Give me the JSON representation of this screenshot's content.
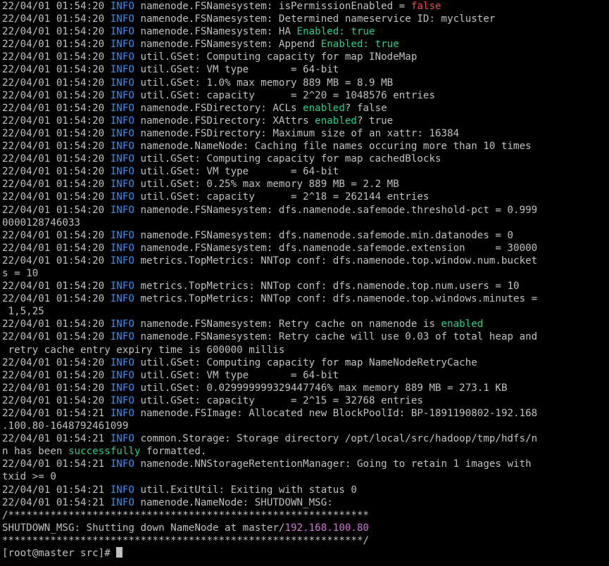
{
  "terminal": {
    "colors": {
      "background": "#000000",
      "foreground": "#c0c0c0",
      "info": "#3b8eea",
      "green": "#23d18b",
      "red": "#f14c4c",
      "magenta": "#d670d6"
    },
    "lines": [
      [
        [
          "22/04/01 01:54:20 ",
          "d"
        ],
        [
          "INFO",
          "i"
        ],
        [
          " namenode.FSNamesystem: isPermissionEnabled = ",
          "d"
        ],
        [
          "false",
          "r"
        ]
      ],
      [
        [
          "22/04/01 01:54:20 ",
          "d"
        ],
        [
          "INFO",
          "i"
        ],
        [
          " namenode.FSNamesystem: Determined nameservice ID: mycluster",
          "d"
        ]
      ],
      [
        [
          "22/04/01 01:54:20 ",
          "d"
        ],
        [
          "INFO",
          "i"
        ],
        [
          " namenode.FSNamesystem: HA ",
          "d"
        ],
        [
          "Enabled: true",
          "g"
        ]
      ],
      [
        [
          "22/04/01 01:54:20 ",
          "d"
        ],
        [
          "INFO",
          "i"
        ],
        [
          " namenode.FSNamesystem: Append ",
          "d"
        ],
        [
          "Enabled: true",
          "g"
        ]
      ],
      [
        [
          "22/04/01 01:54:20 ",
          "d"
        ],
        [
          "INFO",
          "i"
        ],
        [
          " util.GSet: Computing capacity for map INodeMap",
          "d"
        ]
      ],
      [
        [
          "22/04/01 01:54:20 ",
          "d"
        ],
        [
          "INFO",
          "i"
        ],
        [
          " util.GSet: VM type       = 64-bit",
          "d"
        ]
      ],
      [
        [
          "22/04/01 01:54:20 ",
          "d"
        ],
        [
          "INFO",
          "i"
        ],
        [
          " util.GSet: 1.0% max memory 889 MB = 8.9 MB",
          "d"
        ]
      ],
      [
        [
          "22/04/01 01:54:20 ",
          "d"
        ],
        [
          "INFO",
          "i"
        ],
        [
          " util.GSet: capacity      = 2^20 = 1048576 entries",
          "d"
        ]
      ],
      [
        [
          "22/04/01 01:54:20 ",
          "d"
        ],
        [
          "INFO",
          "i"
        ],
        [
          " namenode.FSDirectory: ACLs ",
          "d"
        ],
        [
          "enabled",
          "g"
        ],
        [
          "? false",
          "d"
        ]
      ],
      [
        [
          "22/04/01 01:54:20 ",
          "d"
        ],
        [
          "INFO",
          "i"
        ],
        [
          " namenode.FSDirectory: XAttrs ",
          "d"
        ],
        [
          "enabled",
          "g"
        ],
        [
          "? true",
          "d"
        ]
      ],
      [
        [
          "22/04/01 01:54:20 ",
          "d"
        ],
        [
          "INFO",
          "i"
        ],
        [
          " namenode.FSDirectory: Maximum size of an xattr: 16384",
          "d"
        ]
      ],
      [
        [
          "22/04/01 01:54:20 ",
          "d"
        ],
        [
          "INFO",
          "i"
        ],
        [
          " namenode.NameNode: Caching file names occuring more than 10 times",
          "d"
        ]
      ],
      [
        [
          "22/04/01 01:54:20 ",
          "d"
        ],
        [
          "INFO",
          "i"
        ],
        [
          " util.GSet: Computing capacity for map cachedBlocks",
          "d"
        ]
      ],
      [
        [
          "22/04/01 01:54:20 ",
          "d"
        ],
        [
          "INFO",
          "i"
        ],
        [
          " util.GSet: VM type       = 64-bit",
          "d"
        ]
      ],
      [
        [
          "22/04/01 01:54:20 ",
          "d"
        ],
        [
          "INFO",
          "i"
        ],
        [
          " util.GSet: 0.25% max memory 889 MB = 2.2 MB",
          "d"
        ]
      ],
      [
        [
          "22/04/01 01:54:20 ",
          "d"
        ],
        [
          "INFO",
          "i"
        ],
        [
          " util.GSet: capacity      = 2^18 = 262144 entries",
          "d"
        ]
      ],
      [
        [
          "22/04/01 01:54:20 ",
          "d"
        ],
        [
          "INFO",
          "i"
        ],
        [
          " namenode.FSNamesystem: dfs.namenode.safemode.threshold-pct = 0.999",
          "d"
        ]
      ],
      [
        [
          "0000128746033",
          "d"
        ]
      ],
      [
        [
          "22/04/01 01:54:20 ",
          "d"
        ],
        [
          "INFO",
          "i"
        ],
        [
          " namenode.FSNamesystem: dfs.namenode.safemode.min.datanodes = 0",
          "d"
        ]
      ],
      [
        [
          "22/04/01 01:54:20 ",
          "d"
        ],
        [
          "INFO",
          "i"
        ],
        [
          " namenode.FSNamesystem: dfs.namenode.safemode.extension     = 30000",
          "d"
        ]
      ],
      [
        [
          "22/04/01 01:54:20 ",
          "d"
        ],
        [
          "INFO",
          "i"
        ],
        [
          " metrics.TopMetrics: NNTop conf: dfs.namenode.top.window.num.bucket",
          "d"
        ]
      ],
      [
        [
          "s = 10",
          "d"
        ]
      ],
      [
        [
          "22/04/01 01:54:20 ",
          "d"
        ],
        [
          "INFO",
          "i"
        ],
        [
          " metrics.TopMetrics: NNTop conf: dfs.namenode.top.num.users = 10",
          "d"
        ]
      ],
      [
        [
          "22/04/01 01:54:20 ",
          "d"
        ],
        [
          "INFO",
          "i"
        ],
        [
          " metrics.TopMetrics: NNTop conf: dfs.namenode.top.windows.minutes =",
          "d"
        ]
      ],
      [
        [
          " 1,5,25",
          "d"
        ]
      ],
      [
        [
          "22/04/01 01:54:20 ",
          "d"
        ],
        [
          "INFO",
          "i"
        ],
        [
          " namenode.FSNamesystem: Retry cache on namenode is ",
          "d"
        ],
        [
          "enabled",
          "g"
        ]
      ],
      [
        [
          "22/04/01 01:54:20 ",
          "d"
        ],
        [
          "INFO",
          "i"
        ],
        [
          " namenode.FSNamesystem: Retry cache will use 0.03 of total heap and",
          "d"
        ]
      ],
      [
        [
          " retry cache entry expiry time is 600000 millis",
          "d"
        ]
      ],
      [
        [
          "22/04/01 01:54:20 ",
          "d"
        ],
        [
          "INFO",
          "i"
        ],
        [
          " util.GSet: Computing capacity for map NameNodeRetryCache",
          "d"
        ]
      ],
      [
        [
          "22/04/01 01:54:20 ",
          "d"
        ],
        [
          "INFO",
          "i"
        ],
        [
          " util.GSet: VM type       = 64-bit",
          "d"
        ]
      ],
      [
        [
          "22/04/01 01:54:20 ",
          "d"
        ],
        [
          "INFO",
          "i"
        ],
        [
          " util.GSet: 0.029999999329447746% max memory 889 MB = 273.1 KB",
          "d"
        ]
      ],
      [
        [
          "22/04/01 01:54:20 ",
          "d"
        ],
        [
          "INFO",
          "i"
        ],
        [
          " util.GSet: capacity      = 2^15 = 32768 entries",
          "d"
        ]
      ],
      [
        [
          "22/04/01 01:54:21 ",
          "d"
        ],
        [
          "INFO",
          "i"
        ],
        [
          " namenode.FSImage: Allocated new BlockPoolId: BP-1891190802-192.168",
          "d"
        ]
      ],
      [
        [
          ".100.80-1648792461099",
          "d"
        ]
      ],
      [
        [
          "22/04/01 01:54:21 ",
          "d"
        ],
        [
          "INFO",
          "i"
        ],
        [
          " common.Storage: Storage directory /opt/local/src/hadoop/tmp/hdfs/n",
          "d"
        ]
      ],
      [
        [
          "n has been ",
          "d"
        ],
        [
          "successfully",
          "g"
        ],
        [
          " formatted.",
          "d"
        ]
      ],
      [
        [
          "22/04/01 01:54:21 ",
          "d"
        ],
        [
          "INFO",
          "i"
        ],
        [
          " namenode.NNStorageRetentionManager: Going to retain 1 images with",
          "d"
        ]
      ],
      [
        [
          "txid >= 0",
          "d"
        ]
      ],
      [
        [
          "22/04/01 01:54:21 ",
          "d"
        ],
        [
          "INFO",
          "i"
        ],
        [
          " util.ExitUtil: Exiting with status 0",
          "d"
        ]
      ],
      [
        [
          "22/04/01 01:54:21 ",
          "d"
        ],
        [
          "INFO",
          "i"
        ],
        [
          " namenode.NameNode: SHUTDOWN_MSG:",
          "d"
        ]
      ],
      [
        [
          "/************************************************************",
          "d"
        ]
      ],
      [
        [
          "SHUTDOWN_MSG: Shutting down NameNode at master/",
          "d"
        ],
        [
          "192.168.100.80",
          "m"
        ]
      ],
      [
        [
          "************************************************************/",
          "d"
        ]
      ]
    ],
    "prompt": "[root@master src]# "
  }
}
